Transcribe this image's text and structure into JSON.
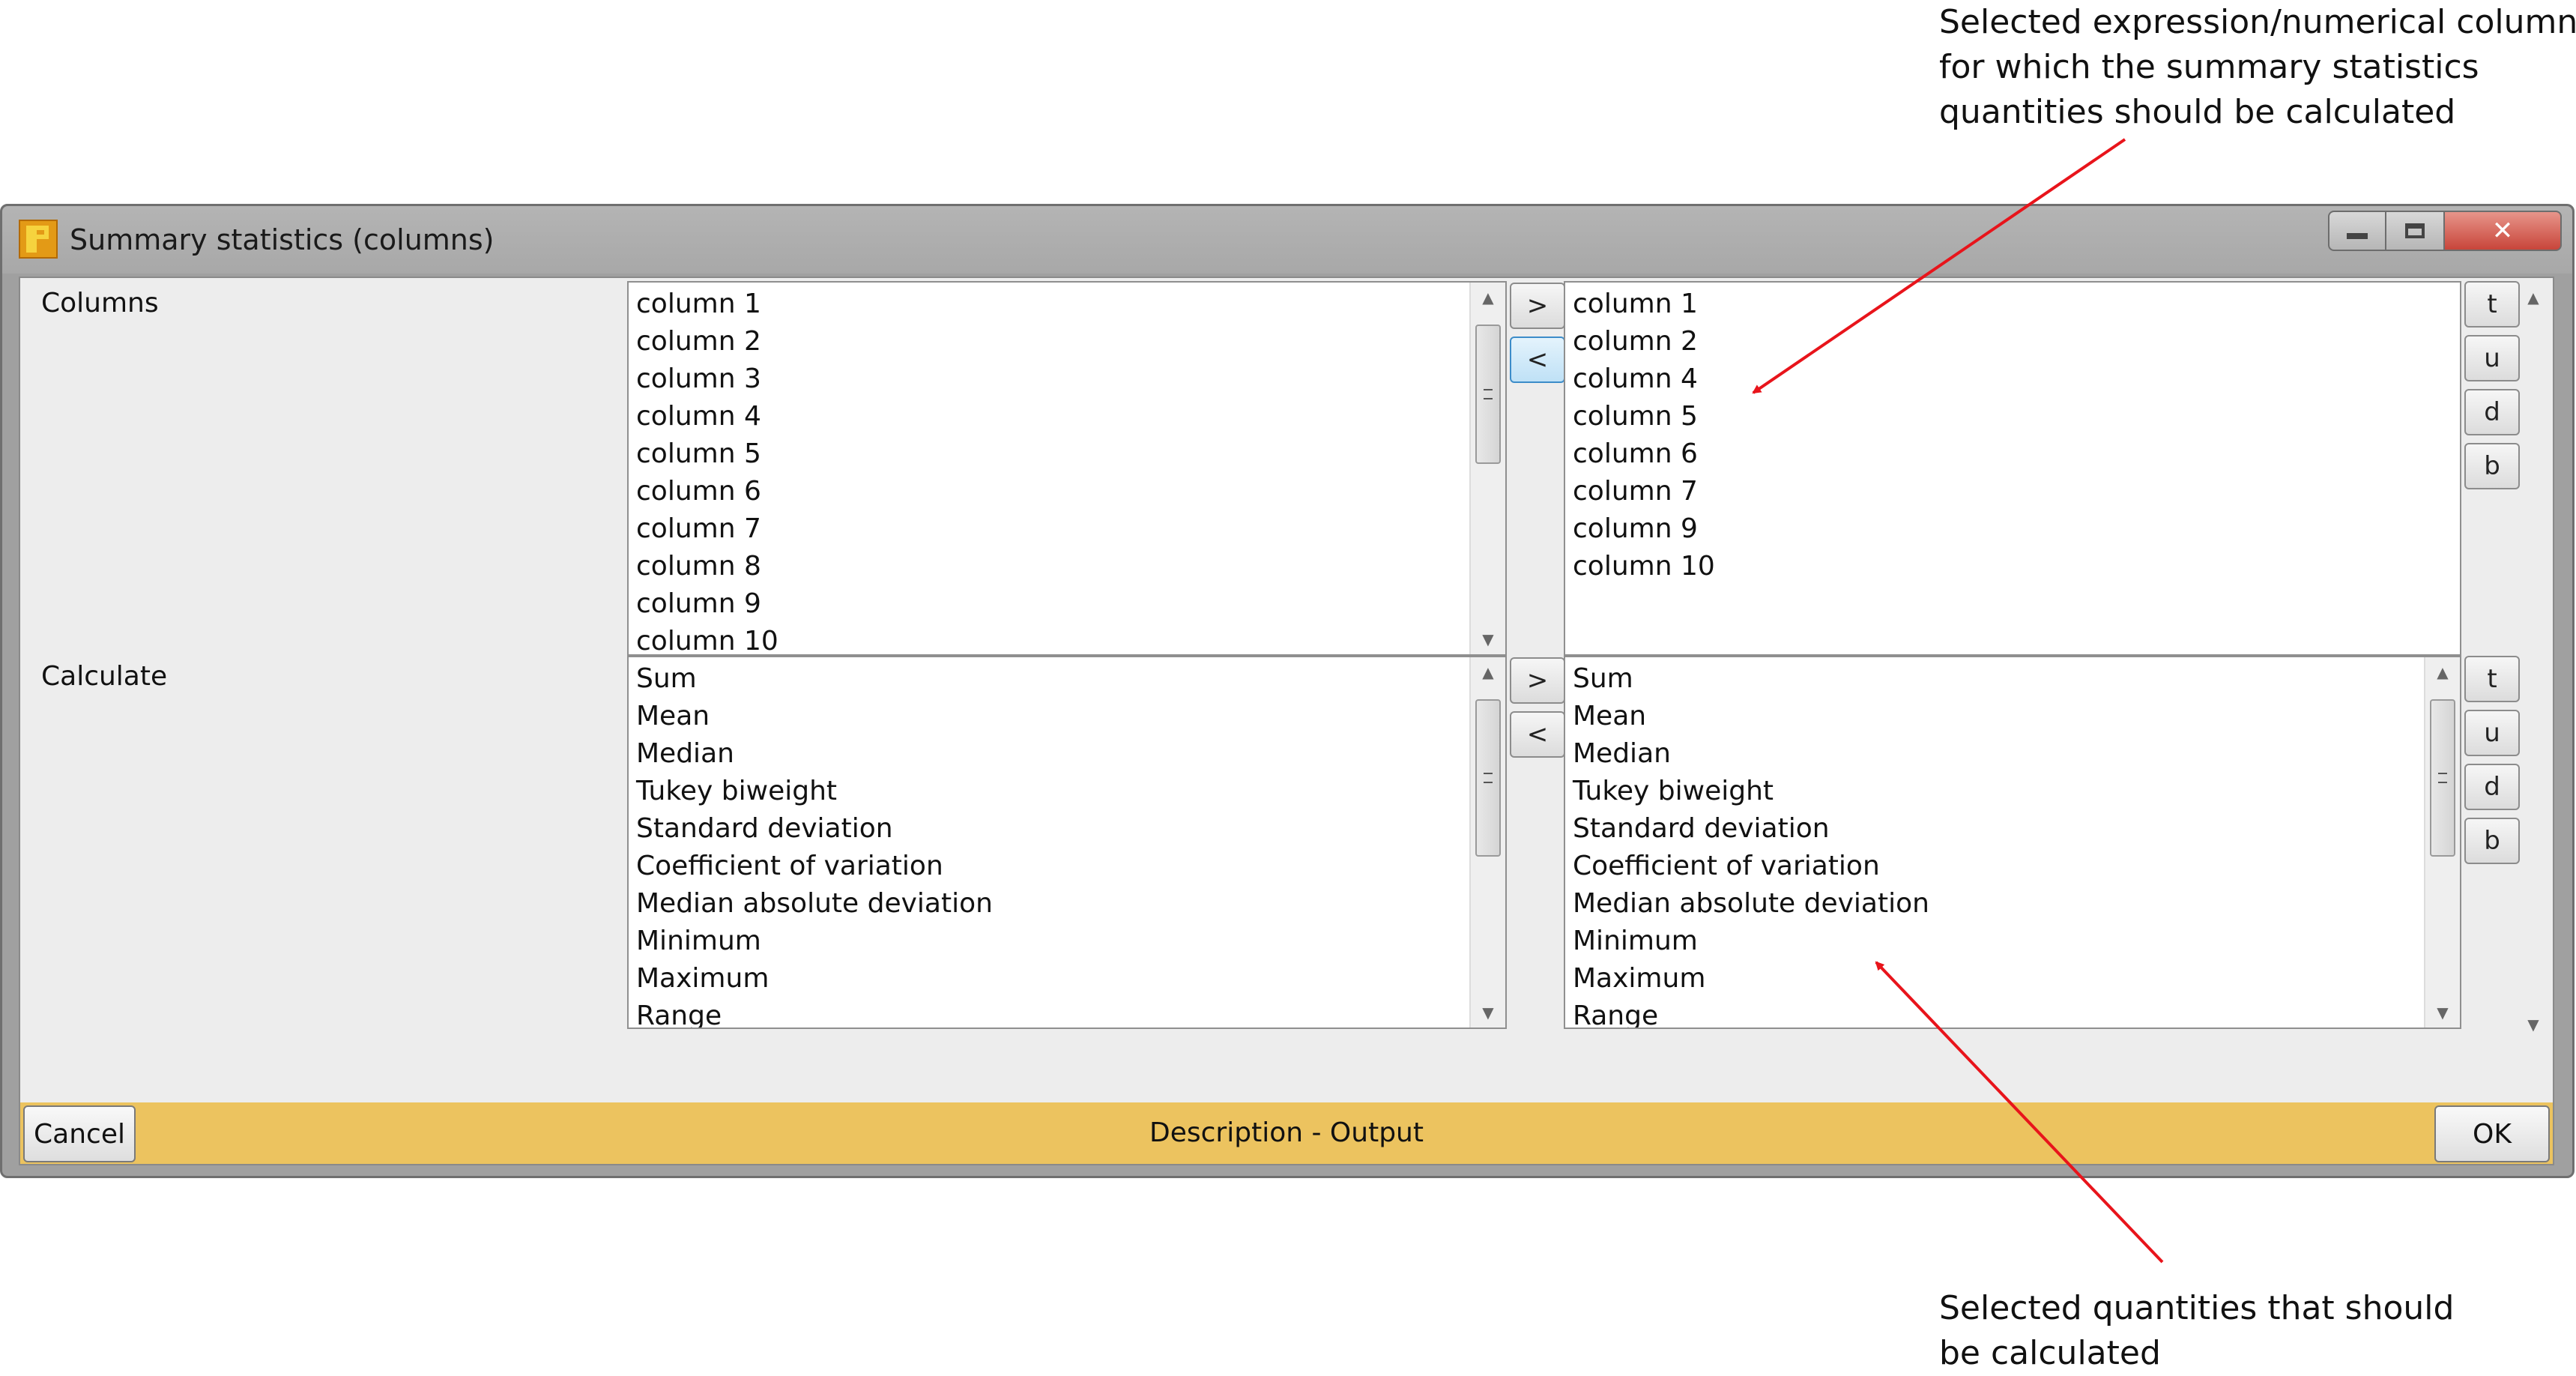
{
  "annotations": {
    "top": [
      "Selected expression/numerical columns",
      "for which the summary statistics",
      "quantities should be calculated"
    ],
    "bottom": [
      "Selected quantities that should",
      "be calculated"
    ],
    "arrow_color": "#e8141b"
  },
  "window": {
    "title": "Summary statistics (columns)",
    "close_label": "✕"
  },
  "columns_section": {
    "label": "Columns",
    "available": [
      "column 1",
      "column 2",
      "column 3",
      "column 4",
      "column 5",
      "column 6",
      "column 7",
      "column 8",
      "column 9",
      "column 10"
    ],
    "selected": [
      "column 1",
      "column 2",
      "column 4",
      "column 5",
      "column 6",
      "column 7",
      "column 9",
      "column 10"
    ]
  },
  "calculate_section": {
    "label": "Calculate",
    "available": [
      "Sum",
      "Mean",
      "Median",
      "Tukey biweight",
      "Standard deviation",
      "Coefficient of variation",
      "Median absolute deviation",
      "Minimum",
      "Maximum",
      "Range"
    ],
    "selected": [
      "Sum",
      "Mean",
      "Median",
      "Tukey biweight",
      "Standard deviation",
      "Coefficient of variation",
      "Median absolute deviation",
      "Minimum",
      "Maximum",
      "Range"
    ]
  },
  "transfer": {
    "add": ">",
    "remove": "<"
  },
  "order_buttons": {
    "top": "t",
    "up": "u",
    "down": "d",
    "bottom": "b"
  },
  "footer": {
    "cancel": "Cancel",
    "description": "Description - Output",
    "ok": "OK",
    "bar_color": "#ecc35f"
  }
}
